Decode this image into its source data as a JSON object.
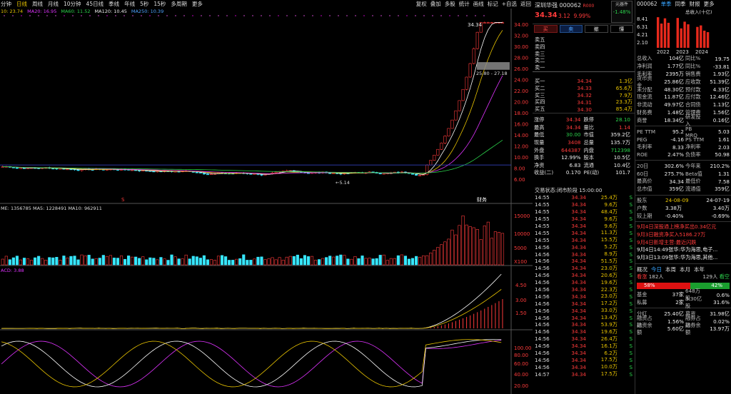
{
  "toolbar": {
    "items": [
      "分钟",
      "日线",
      "周线",
      "月线",
      "10分钟",
      "45日线",
      "季线",
      "年线",
      "5秒",
      "15秒",
      "多周期",
      "更多"
    ],
    "active_index": 1,
    "right": [
      "复权",
      "叠加",
      "多股",
      "统计",
      "画线",
      "标记",
      "+自选",
      "返回"
    ]
  },
  "ma": {
    "ma5": "10: 23.74",
    "ma20": "MA20: 16.95",
    "ma60": "MA60: 11.52",
    "ma120": "MA120: 10.45",
    "ma250": "MA250: 10.39"
  },
  "price_axis": [
    "34.00",
    "32.00",
    "30.00",
    "28.00",
    "26.00",
    "24.00",
    "22.00",
    "20.00",
    "18.00",
    "16.00",
    "14.00",
    "12.00",
    "10.00",
    "8.00",
    "6.00"
  ],
  "chart_labels": {
    "high": "34.34",
    "low": "5.14",
    "range": "25.80 - 27.18",
    "event1": "财务",
    "event2": "S"
  },
  "volume": {
    "legend": "ME: 1356785  MA5: 1228491  MA10: 962911",
    "ticks": [
      "15000",
      "10000",
      "5000",
      "X100"
    ]
  },
  "macd": {
    "legend": "ACD: 3.88",
    "ticks": [
      "4.50",
      "3.00",
      "1.50"
    ]
  },
  "kdj": {
    "ticks": [
      "100.00",
      "80.00",
      "60.00",
      "40.00",
      "20.00"
    ]
  },
  "quote": {
    "name": "深圳华强 000062",
    "tag": "R000",
    "price": "34.34",
    "change": "3.12",
    "pct": "9.99%",
    "yuan_label": "元器件",
    "yuan_pct": "-1.48%"
  },
  "buttons": [
    "买",
    "卖",
    "撤",
    "懂"
  ],
  "asks": [
    {
      "l": "卖五",
      "p": "",
      "v": ""
    },
    {
      "l": "卖四",
      "p": "",
      "v": ""
    },
    {
      "l": "卖三",
      "p": "",
      "v": ""
    },
    {
      "l": "卖二",
      "p": "",
      "v": ""
    },
    {
      "l": "卖一",
      "p": "",
      "v": ""
    }
  ],
  "bids": [
    {
      "l": "买一",
      "p": "34.34",
      "v": "1.3亿"
    },
    {
      "l": "买二",
      "p": "34.33",
      "v": "65.6万"
    },
    {
      "l": "买三",
      "p": "34.32",
      "v": "7.9万"
    },
    {
      "l": "买四",
      "p": "34.31",
      "v": "23.3万"
    },
    {
      "l": "买五",
      "p": "34.30",
      "v": "85.4万"
    }
  ],
  "ask_label": "卖五 ¥",
  "stats": [
    [
      {
        "k": "涨停",
        "v": "34.34",
        "c": "red"
      },
      {
        "k": "跌停",
        "v": "28.10",
        "c": "grn"
      }
    ],
    [
      {
        "k": "最高",
        "v": "34.34",
        "c": "red"
      },
      {
        "k": "量比",
        "v": "1.14",
        "c": "red"
      }
    ],
    [
      {
        "k": "最低",
        "v": "30.00",
        "c": "grn"
      },
      {
        "k": "市值",
        "v": "359.2亿",
        "c": "wht"
      }
    ],
    [
      {
        "k": "现量",
        "v": "3408",
        "c": "red"
      },
      {
        "k": "总量",
        "v": "135.7万",
        "c": "wht"
      }
    ],
    [
      {
        "k": "外盘",
        "v": "644387",
        "c": "red"
      },
      {
        "k": "内盘",
        "v": "712398",
        "c": "grn"
      }
    ],
    [
      {
        "k": "换手",
        "v": "12.99%",
        "c": "wht"
      },
      {
        "k": "股本",
        "v": "10.5亿",
        "c": "wht"
      }
    ],
    [
      {
        "k": "净资",
        "v": "6.83",
        "c": "wht"
      },
      {
        "k": "流通",
        "v": "10.4亿",
        "c": "wht"
      }
    ],
    [
      {
        "k": "收益(二)",
        "v": "0.170",
        "c": "wht"
      },
      {
        "k": "PE(动)",
        "v": "101.7",
        "c": "wht"
      }
    ]
  ],
  "trade_status": "交易状态:闭市阶段 15:00:00",
  "trades": [
    [
      "14:55",
      "34.34",
      "25.4万",
      "S"
    ],
    [
      "14:55",
      "34.34",
      "9.6万",
      "S"
    ],
    [
      "14:55",
      "34.34",
      "48.4万",
      "S"
    ],
    [
      "14:55",
      "34.34",
      "9.6万",
      "S"
    ],
    [
      "14:55",
      "34.34",
      "9.6万",
      "S"
    ],
    [
      "14:55",
      "34.34",
      "11.3万",
      "S"
    ],
    [
      "14:55",
      "34.34",
      "15.5万",
      "S"
    ],
    [
      "14:56",
      "34.34",
      "5.2万",
      "S"
    ],
    [
      "14:56",
      "34.34",
      "8.9万",
      "S"
    ],
    [
      "14:56",
      "34.34",
      "51.5万",
      "S"
    ],
    [
      "14:56",
      "34.34",
      "23.0万",
      "S"
    ],
    [
      "14:56",
      "34.34",
      "20.6万",
      "S"
    ],
    [
      "14:56",
      "34.34",
      "19.6万",
      "S"
    ],
    [
      "14:56",
      "34.34",
      "22.3万",
      "S"
    ],
    [
      "14:56",
      "34.34",
      "23.0万",
      "S"
    ],
    [
      "14:56",
      "34.34",
      "17.2万",
      "S"
    ],
    [
      "14:56",
      "34.34",
      "33.0万",
      "S"
    ],
    [
      "14:56",
      "34.34",
      "13.4万",
      "S"
    ],
    [
      "14:56",
      "34.34",
      "53.9万",
      "S"
    ],
    [
      "14:56",
      "34.34",
      "19.6万",
      "S"
    ],
    [
      "14:56",
      "34.34",
      "26.4万",
      "S"
    ],
    [
      "14:56",
      "34.34",
      "16.1万",
      "S"
    ],
    [
      "14:56",
      "34.34",
      "6.2万",
      "S"
    ],
    [
      "14:56",
      "34.34",
      "17.5万",
      "S"
    ],
    [
      "14:56",
      "34.34",
      "10.0万",
      "S"
    ],
    [
      "14:57",
      "34.34",
      "17.5万",
      "S"
    ]
  ],
  "f10": {
    "tabs": [
      "000062",
      "单季",
      "同季",
      "财报",
      "更多"
    ],
    "chart_years": [
      "2022",
      "2023",
      "2024"
    ],
    "chart_ticks": [
      "8.41",
      "6.31",
      "4.21",
      "2.10"
    ],
    "chart_unit": "总收入(十亿)",
    "bars": [
      8.2,
      6.5,
      7.9,
      6.7,
      8.0,
      5.2,
      7.0,
      6.3,
      5.6,
      6.0,
      4.6,
      4.2
    ],
    "rows1": [
      [
        "总收入",
        "104亿",
        "同比%",
        "19.75"
      ],
      [
        "净利润",
        "1.77亿",
        "同比%",
        "-33.81"
      ],
      [
        "毛利率",
        "2395万",
        "销售费",
        "1.93亿"
      ],
      [
        "货币资金",
        "25.86亿",
        "应收款",
        "51.39亿"
      ],
      [
        "未分配",
        "48.30亿",
        "预付款",
        "4.33亿"
      ],
      [
        "现金流",
        "11.87亿",
        "应付款",
        "12.46亿"
      ],
      [
        "非流动",
        "49.97亿",
        "合同债",
        "1.13亿"
      ],
      [
        "财务费",
        "1.48亿",
        "管理费",
        "1.56亿"
      ],
      [
        "商誉",
        "18.34亿",
        "研发投入",
        "0.16亿"
      ]
    ],
    "rows2": [
      [
        "PE TTM",
        "95.2",
        "PB MRQ",
        "5.03"
      ],
      [
        "PEG",
        "-4.16",
        "PS TTM",
        "1.61"
      ],
      [
        "毛利率",
        "8.33",
        "净利率",
        "2.03"
      ],
      [
        "ROE",
        "2.47%",
        "负债率",
        "50.98"
      ]
    ],
    "rows3": [
      [
        "20日",
        "302.6%",
        "今年来",
        "210.2%"
      ],
      [
        "60日",
        "275.7%",
        "Beta值",
        "1.31"
      ],
      [
        "最高价",
        "34.34",
        "最低价",
        "7.58"
      ],
      [
        "总市值",
        "359亿",
        "流通值",
        "359亿"
      ]
    ],
    "holder_hdr": [
      "股东",
      "24-08-09",
      "24-07-19"
    ],
    "rows4": [
      [
        "户数",
        "3.38万",
        "3.40万"
      ],
      [
        "较上期",
        "-0.40%",
        "-0.69%"
      ]
    ],
    "news": [
      "9月4日深股通上榜净买出0.34亿元",
      "9月3日融资净买入5186.27万",
      "9月4日新增主营:最近闪跌",
      "9月4日14:49张华:华为海思,电子...",
      "9月3日13:09张华:华为海思,其他..."
    ],
    "flow_tabs": [
      "概况",
      "今日",
      "本周",
      "本月",
      "本年"
    ],
    "flow_counts": [
      "看涨",
      "182人",
      "129人",
      "看空"
    ],
    "flow_pct": [
      "58%",
      "42%"
    ],
    "rows5": [
      [
        "基金",
        "37家",
        "648万股",
        "0.6%"
      ],
      [
        "私募",
        "2家",
        "3.30亿股",
        "31.6%"
      ]
    ],
    "rows6": [
      [
        "分红",
        "25.40亿",
        "募资",
        "31.98亿"
      ],
      [
        "融资占比",
        "1.56%",
        "融券占比",
        "0.02%"
      ]
    ],
    "bottom": [
      "融资余额",
      "5.60亿",
      "融券余额",
      "13.97万"
    ]
  }
}
